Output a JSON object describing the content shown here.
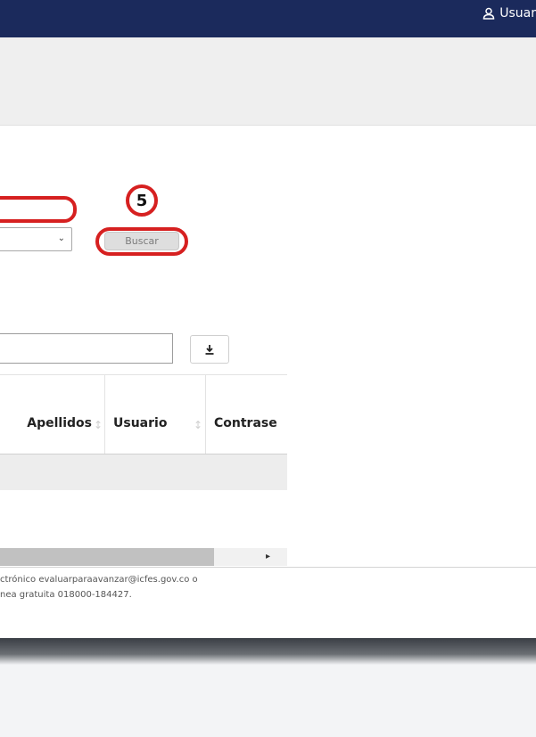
{
  "header": {
    "user_label": "Usuar"
  },
  "form": {
    "step_number": "5",
    "search_button_label": "Buscar"
  },
  "table": {
    "columns": [
      "Apellidos",
      "Usuario",
      "Contrase"
    ]
  },
  "footer": {
    "line1": "ctrónico evaluarparaavanzar@icfes.gov.co o",
    "line2": "nea gratuita 018000-184427."
  },
  "colors": {
    "header_bg": "#1b2a5c",
    "highlight": "#d62020"
  }
}
